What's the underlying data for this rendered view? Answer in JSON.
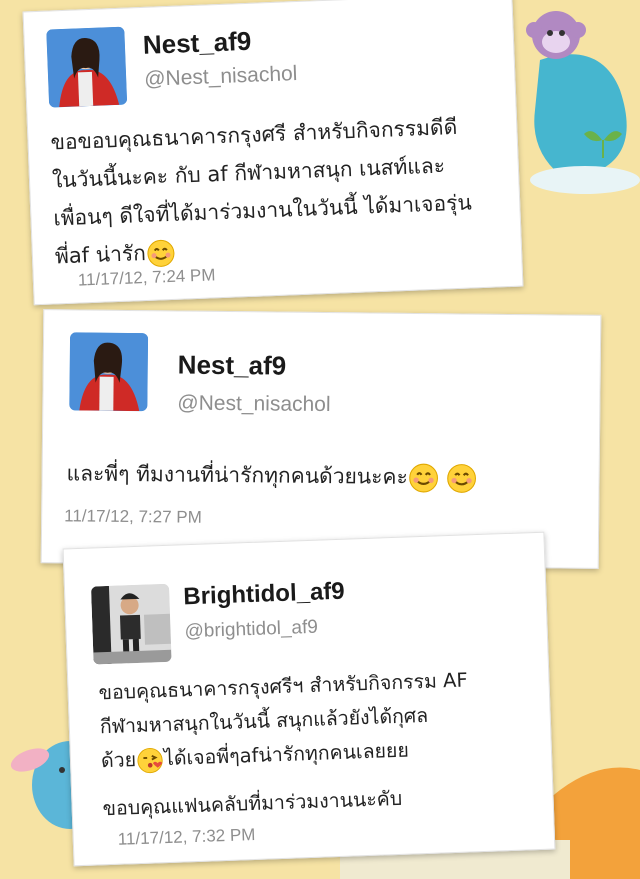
{
  "colors": {
    "background": "#f6e3a4",
    "card": "#ffffff",
    "name_text": "#1a1a1a",
    "handle_text": "#8e8e8e",
    "body_text": "#222222"
  },
  "tweets": [
    {
      "name": "Nest_af9",
      "handle": "@Nest_nisachol",
      "lines": [
        "ขอขอบคุณธนาคารกรุงศรี สำหรับกิจกรรมดีดี",
        "ในวันนี้นะคะ กับ af กีฬามหาสนุก เนสท์และ",
        "เพื่อนๆ ดีใจที่ได้มาร่วมงานในวันนี้ ได้มาเจอรุ่น",
        "พี่af น่ารัก"
      ],
      "emojis": [
        "smiling-face-emoji"
      ],
      "timestamp": "11/17/12, 7:24 PM"
    },
    {
      "name": "Nest_af9",
      "handle": "@Nest_nisachol",
      "lines": [
        "และพี่ๆ ทีมงานที่น่ารักทุกคนด้วยนะคะ"
      ],
      "emojis": [
        "smiling-face-emoji",
        "smiling-face-emoji"
      ],
      "timestamp": "11/17/12, 7:27 PM"
    },
    {
      "name": "Brightidol_af9",
      "handle": "@brightidol_af9",
      "lines": [
        "ขอบคุณธนาคารกรุงศรีฯ สำหรับกิจกรรม AF",
        "กีฬามหาสนุกในวันนี้ สนุกแล้วยังได้กุศล",
        "ด้วย",
        "ได้เจอพี่ๆafน่ารักทุกคนเลยยย",
        "ขอบคุณแฟนคลับที่มาร่วมงานนะคับ"
      ],
      "emojis": [
        "kissing-face-emoji"
      ],
      "timestamp": "11/17/12, 7:32 PM"
    }
  ]
}
